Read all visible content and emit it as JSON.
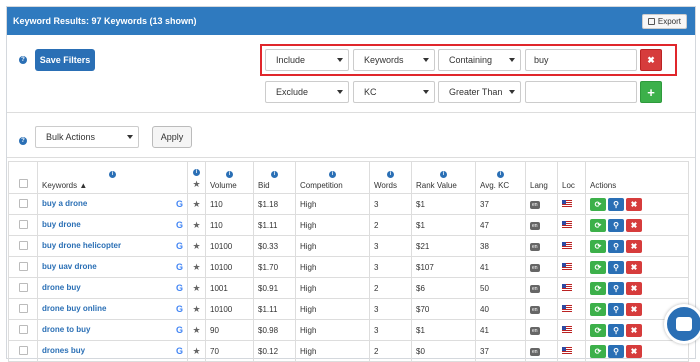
{
  "header": {
    "title": "Keyword Results: 97 Keywords (13 shown)",
    "export_label": "Export"
  },
  "toolbar": {
    "save_filters": "Save Filters",
    "apply": "Apply",
    "bulk_actions": "Bulk Actions"
  },
  "filters": [
    {
      "mode": "Include",
      "field": "Keywords",
      "operator": "Containing",
      "value": "buy",
      "action": "remove"
    },
    {
      "mode": "Exclude",
      "field": "KC",
      "operator": "Greater Than",
      "value": "",
      "action": "add"
    }
  ],
  "table": {
    "headers": {
      "keywords": "Keywords",
      "volume": "Volume",
      "bid": "Bid",
      "competition": "Competition",
      "words": "Words",
      "rank_value": "Rank Value",
      "avg_kc": "Avg. KC",
      "lang": "Lang",
      "loc": "Loc",
      "actions": "Actions"
    },
    "rows": [
      {
        "keyword": "buy a drone",
        "volume": "110",
        "bid": "$1.18",
        "competition": "High",
        "words": "3",
        "rank_value": "$1",
        "avg_kc": "37",
        "lang": "en"
      },
      {
        "keyword": "buy drone",
        "volume": "110",
        "bid": "$1.11",
        "competition": "High",
        "words": "2",
        "rank_value": "$1",
        "avg_kc": "47",
        "lang": "en"
      },
      {
        "keyword": "buy drone helicopter",
        "volume": "10100",
        "bid": "$0.33",
        "competition": "High",
        "words": "3",
        "rank_value": "$21",
        "avg_kc": "38",
        "lang": "en"
      },
      {
        "keyword": "buy uav drone",
        "volume": "10100",
        "bid": "$1.70",
        "competition": "High",
        "words": "3",
        "rank_value": "$107",
        "avg_kc": "41",
        "lang": "en"
      },
      {
        "keyword": "drone buy",
        "volume": "1001",
        "bid": "$0.91",
        "competition": "High",
        "words": "2",
        "rank_value": "$6",
        "avg_kc": "50",
        "lang": "en"
      },
      {
        "keyword": "drone buy online",
        "volume": "10100",
        "bid": "$1.11",
        "competition": "High",
        "words": "3",
        "rank_value": "$70",
        "avg_kc": "40",
        "lang": "en"
      },
      {
        "keyword": "drone to buy",
        "volume": "90",
        "bid": "$0.98",
        "competition": "High",
        "words": "3",
        "rank_value": "$1",
        "avg_kc": "41",
        "lang": "en"
      },
      {
        "keyword": "drones buy",
        "volume": "70",
        "bid": "$0.12",
        "competition": "High",
        "words": "2",
        "rank_value": "$0",
        "avg_kc": "37",
        "lang": "en"
      }
    ]
  },
  "colors": {
    "header": "#2f7abf",
    "primary": "#2a6fb5",
    "danger": "#d63c3c",
    "success": "#3cb04a",
    "highlight_border": "#e0262b"
  }
}
